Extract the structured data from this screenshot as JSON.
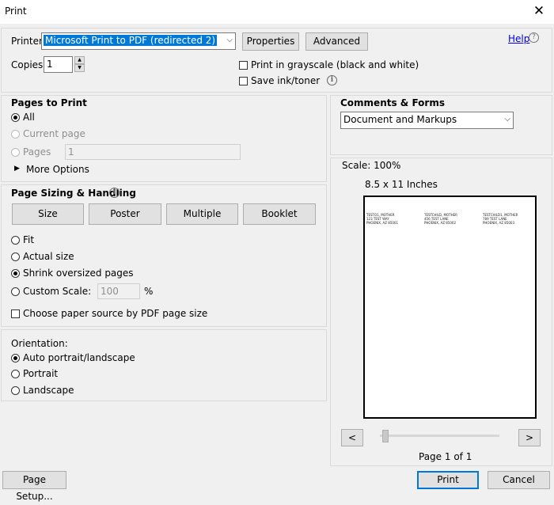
{
  "window": {
    "title": "Print",
    "close_glyph": "✕"
  },
  "printer": {
    "label": "Printer:",
    "selected": "Microsoft Print to PDF (redirected 2)",
    "properties_label": "Properties",
    "advanced_label": "Advanced",
    "help_label": "Help"
  },
  "copies": {
    "label": "Copies:",
    "value": "1"
  },
  "options": {
    "grayscale_label": "Print in grayscale (black and white)",
    "save_ink_label": "Save ink/toner"
  },
  "pages_to_print": {
    "heading": "Pages to Print",
    "all_label": "All",
    "current_page_label": "Current page",
    "pages_label": "Pages",
    "pages_value": "1",
    "more_options_label": "More Options"
  },
  "comments_forms": {
    "heading": "Comments & Forms",
    "selected": "Document and Markups"
  },
  "preview": {
    "scale_label": "Scale: 100%",
    "paper_size_label": "8.5 x 11 Inches",
    "page_indicator": "Page 1 of 1",
    "addresses": [
      "TESTO1, MOTHER\n123 TEST WAY\nPHOENIX, AZ 85001",
      "TESTCHILD, MOTHER\n456 TEST LANE\nPHOENIX, AZ 85002",
      "TESTCHILD1, MOTHER\n789 TEST LANE\nPHOENIX, AZ 85003"
    ],
    "prev_label": "<",
    "next_label": ">"
  },
  "page_sizing": {
    "heading": "Page Sizing & Handling",
    "tabs": [
      "Size",
      "Poster",
      "Multiple",
      "Booklet"
    ],
    "fit_label": "Fit",
    "actual_size_label": "Actual size",
    "shrink_label": "Shrink oversized pages",
    "custom_scale_label": "Custom Scale:",
    "custom_scale_value": "100",
    "percent_sign": "%",
    "paper_source_label": "Choose paper source by PDF page size"
  },
  "orientation": {
    "heading": "Orientation:",
    "auto_label": "Auto portrait/landscape",
    "portrait_label": "Portrait",
    "landscape_label": "Landscape"
  },
  "footer": {
    "page_setup_label": "Page Setup...",
    "print_label": "Print",
    "cancel_label": "Cancel"
  },
  "colors": {
    "selection_blue": "#0078d7",
    "link_blue": "#0000ee"
  }
}
